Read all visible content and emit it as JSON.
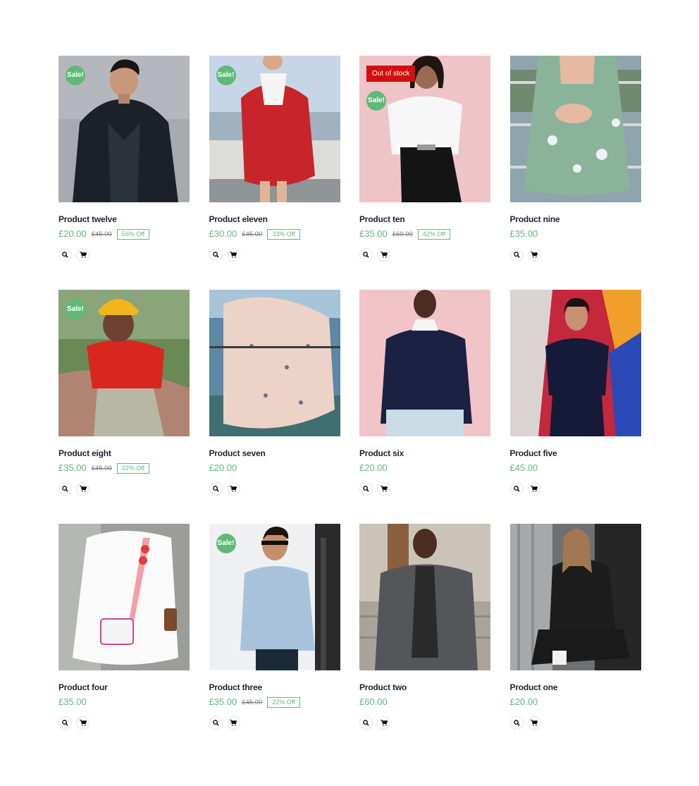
{
  "products": [
    {
      "title": "Product twelve",
      "price": "£20.00",
      "old_price": "£45.00",
      "off": "56% Off",
      "sale": "Sale!"
    },
    {
      "title": "Product eleven",
      "price": "£30.00",
      "old_price": "£45.00",
      "off": "33% Off",
      "sale": "Sale!"
    },
    {
      "title": "Product ten",
      "price": "£35.00",
      "old_price": "£60.00",
      "off": "42% Off",
      "sale": "Sale!",
      "stock": "Out of stock"
    },
    {
      "title": "Product nine",
      "price": "£35.00"
    },
    {
      "title": "Product eight",
      "price": "£35.00",
      "old_price": "£45.00",
      "off": "22% Off",
      "sale": "Sale!"
    },
    {
      "title": "Product seven",
      "price": "£20.00"
    },
    {
      "title": "Product six",
      "price": "£20.00"
    },
    {
      "title": "Product five",
      "price": "£45.00"
    },
    {
      "title": "Product four",
      "price": "£35.00"
    },
    {
      "title": "Product three",
      "price": "£35.00",
      "old_price": "£45.00",
      "off": "22% Off",
      "sale": "Sale!"
    },
    {
      "title": "Product two",
      "price": "£60.00"
    },
    {
      "title": "Product one",
      "price": "£20.00"
    }
  ],
  "icons": {
    "quick_view": "search-icon",
    "add_to_cart": "cart-icon"
  },
  "colors": {
    "accent": "#5fb978",
    "out_of_stock": "#d20f0f",
    "title": "#1d2231"
  }
}
